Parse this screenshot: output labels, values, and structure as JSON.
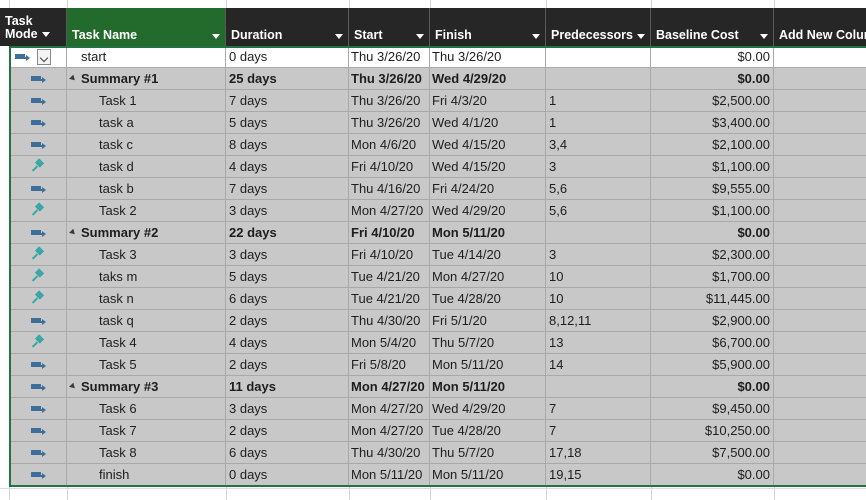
{
  "columns": {
    "mode_line1": "Task",
    "mode_line2": "Mode",
    "name": "Task Name",
    "duration": "Duration",
    "start": "Start",
    "finish": "Finish",
    "predecessors": "Predecessors",
    "baseline_cost": "Baseline Cost",
    "add_new": "Add New Column"
  },
  "colors": {
    "header_bg": "#262626",
    "selected_header_bg": "#226b2c",
    "row_bg": "#c8c8c8",
    "auto_icon": "#3d6f9a",
    "manual_icon": "#3aa6a6",
    "active_border": "#217346"
  },
  "rows": [
    {
      "mode": "auto-schedule-icon",
      "name": "start",
      "duration": "0 days",
      "start": "Thu 3/26/20",
      "finish": "Thu 3/26/20",
      "predecessors": "",
      "cost": "$0.00",
      "summary": false,
      "first": true
    },
    {
      "mode": "auto-schedule-icon",
      "name": "Summary #1",
      "duration": "25 days",
      "start": "Thu 3/26/20",
      "finish": "Wed 4/29/20",
      "predecessors": "",
      "cost": "$0.00",
      "summary": true
    },
    {
      "mode": "auto-schedule-icon",
      "name": "Task 1",
      "duration": "7 days",
      "start": "Thu 3/26/20",
      "finish": "Fri 4/3/20",
      "predecessors": "1",
      "cost": "$2,500.00",
      "summary": false
    },
    {
      "mode": "auto-schedule-icon",
      "name": "task a",
      "duration": "5 days",
      "start": "Thu 3/26/20",
      "finish": "Wed 4/1/20",
      "predecessors": "1",
      "cost": "$3,400.00",
      "summary": false
    },
    {
      "mode": "auto-schedule-icon",
      "name": "task c",
      "duration": "8 days",
      "start": "Mon 4/6/20",
      "finish": "Wed 4/15/20",
      "predecessors": "3,4",
      "cost": "$2,100.00",
      "summary": false
    },
    {
      "mode": "manual-schedule-pin-icon",
      "name": "task d",
      "duration": "4 days",
      "start": "Fri 4/10/20",
      "finish": "Wed 4/15/20",
      "predecessors": "3",
      "cost": "$1,100.00",
      "summary": false
    },
    {
      "mode": "auto-schedule-icon",
      "name": "task b",
      "duration": "7 days",
      "start": "Thu 4/16/20",
      "finish": "Fri 4/24/20",
      "predecessors": "5,6",
      "cost": "$9,555.00",
      "summary": false
    },
    {
      "mode": "manual-schedule-pin-icon",
      "name": "Task 2",
      "duration": "3 days",
      "start": "Mon 4/27/20",
      "finish": "Wed 4/29/20",
      "predecessors": "5,6",
      "cost": "$1,100.00",
      "summary": false
    },
    {
      "mode": "auto-schedule-icon",
      "name": "Summary #2",
      "duration": "22 days",
      "start": "Fri 4/10/20",
      "finish": "Mon 5/11/20",
      "predecessors": "",
      "cost": "$0.00",
      "summary": true
    },
    {
      "mode": "manual-schedule-pin-icon",
      "name": "Task 3",
      "duration": "3 days",
      "start": "Fri 4/10/20",
      "finish": "Tue 4/14/20",
      "predecessors": "3",
      "cost": "$2,300.00",
      "summary": false
    },
    {
      "mode": "manual-schedule-pin-icon",
      "name": "taks m",
      "duration": "5 days",
      "start": "Tue 4/21/20",
      "finish": "Mon 4/27/20",
      "predecessors": "10",
      "cost": "$1,700.00",
      "summary": false
    },
    {
      "mode": "manual-schedule-pin-icon",
      "name": "task n",
      "duration": "6 days",
      "start": "Tue 4/21/20",
      "finish": "Tue 4/28/20",
      "predecessors": "10",
      "cost": "$11,445.00",
      "summary": false
    },
    {
      "mode": "auto-schedule-icon",
      "name": "task q",
      "duration": "2 days",
      "start": "Thu 4/30/20",
      "finish": "Fri 5/1/20",
      "predecessors": "8,12,11",
      "cost": "$2,900.00",
      "summary": false
    },
    {
      "mode": "manual-schedule-pin-icon",
      "name": "Task 4",
      "duration": "4 days",
      "start": "Mon 5/4/20",
      "finish": "Thu 5/7/20",
      "predecessors": "13",
      "cost": "$6,700.00",
      "summary": false
    },
    {
      "mode": "auto-schedule-icon",
      "name": "Task 5",
      "duration": "2 days",
      "start": "Fri 5/8/20",
      "finish": "Mon 5/11/20",
      "predecessors": "14",
      "cost": "$5,900.00",
      "summary": false
    },
    {
      "mode": "auto-schedule-icon",
      "name": "Summary #3",
      "duration": "11 days",
      "start": "Mon 4/27/20",
      "finish": "Mon 5/11/20",
      "predecessors": "",
      "cost": "$0.00",
      "summary": true
    },
    {
      "mode": "auto-schedule-icon",
      "name": "Task 6",
      "duration": "3 days",
      "start": "Mon 4/27/20",
      "finish": "Wed 4/29/20",
      "predecessors": "7",
      "cost": "$9,450.00",
      "summary": false
    },
    {
      "mode": "auto-schedule-icon",
      "name": "Task 7",
      "duration": "2 days",
      "start": "Mon 4/27/20",
      "finish": "Tue 4/28/20",
      "predecessors": "7",
      "cost": "$10,250.00",
      "summary": false
    },
    {
      "mode": "auto-schedule-icon",
      "name": "Task 8",
      "duration": "6 days",
      "start": "Thu 4/30/20",
      "finish": "Thu 5/7/20",
      "predecessors": "17,18",
      "cost": "$7,500.00",
      "summary": false
    },
    {
      "mode": "auto-schedule-icon",
      "name": "finish",
      "duration": "0 days",
      "start": "Mon 5/11/20",
      "finish": "Mon 5/11/20",
      "predecessors": "19,15",
      "cost": "$0.00",
      "summary": false
    }
  ]
}
